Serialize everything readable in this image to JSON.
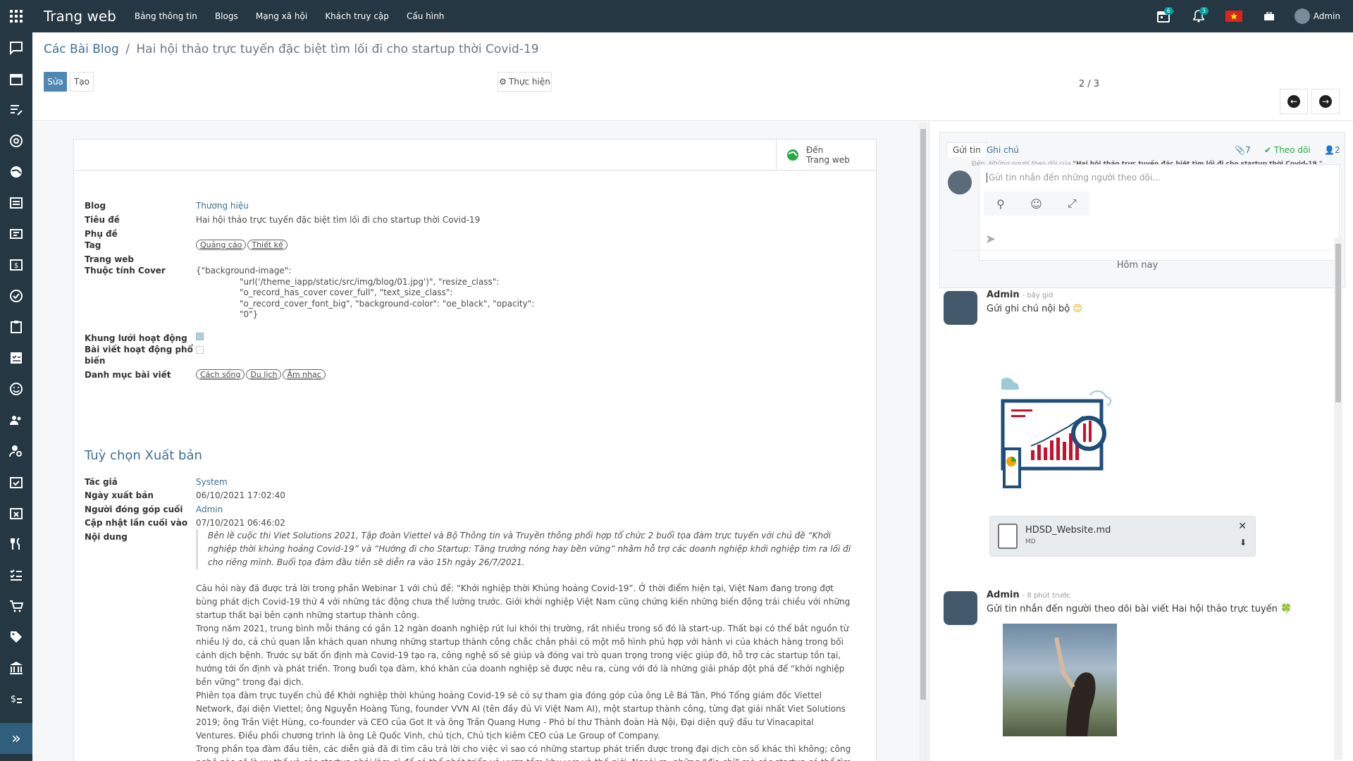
{
  "topbar": {
    "brand": "Trang web",
    "menu": [
      "Bảng thông tin",
      "Blogs",
      "Mạng xã hội",
      "Khách truy cập",
      "Cấu hình"
    ],
    "calendar_badge": "6",
    "bell_badge": "3",
    "user": "Admin"
  },
  "breadcrumb": {
    "parent": "Các Bài Blog",
    "sep": "/",
    "current": "Hai hội thảo trực tuyến đặc biệt tìm lối đi cho startup thời Covid-19"
  },
  "toolbar": {
    "edit": "Sửa",
    "create": "Tạo",
    "action": "Thực hiện",
    "pager": "2 / 3"
  },
  "smart": {
    "line1": "Đến",
    "line2": "Trang web"
  },
  "fields": {
    "blog_label": "Blog",
    "blog_value": "Thương hiệu",
    "title_label": "Tiêu đề",
    "title_value": "Hai hội thảo trực tuyến đặc biệt tìm lối đi cho startup thời Covid-19",
    "subtitle_label": "Phụ đề",
    "tag_label": "Tag",
    "tags": [
      "Quảng cáo",
      "Thiết kế"
    ],
    "website_label": "Trang web",
    "cover_label": "Thuộc tính Cover",
    "cover_lines": [
      "{\"background-image\":",
      "\"url('/theme_iapp/static/src/img/blog/01.jpg')\", \"resize_class\":",
      "\"o_record_has_cover cover_full\", \"text_size_class\":",
      "\"o_record_cover_font_big\", \"background-color\": \"oe_black\", \"opacity\":",
      "\"0\"}"
    ],
    "grid_label": "Khung lưới hoạt động",
    "popular_label1": "Bài viết hoạt động phổ",
    "popular_label2": "biến",
    "category_label": "Danh mục bài viết",
    "categories": [
      "Cách sống",
      "Du lịch",
      "Âm nhạc"
    ]
  },
  "publish": {
    "section": "Tuỳ chọn Xuất bản",
    "author_label": "Tác giả",
    "author": "System",
    "pubdate_label": "Ngày xuất bản",
    "pubdate": "06/10/2021 17:02:40",
    "contrib_label": "Người đóng góp cuối",
    "contrib": "Admin",
    "updated_label": "Cập nhật lần cuối vào",
    "updated": "07/10/2021 06:46:02",
    "content_label": "Nội dung"
  },
  "content": {
    "quote": "Bên lề cuộc thi Viet Solutions 2021, Tập đoàn Viettel và Bộ Thông tin và Truyền thông phối hợp tổ chức 2 buổi tọa đàm trực tuyến với chủ đề “Khởi nghiệp thời khủng hoảng Covid-19” và “Hướng đi cho Startup: Tăng trưởng nóng hay bền vững” nhằm hỗ trợ các doanh nghiệp khởi nghiệp tìm ra lối đi cho riêng mình. Buổi tọa đàm đầu tiên sẽ diễn ra vào 15h ngày 26/7/2021.",
    "p1": "Câu hỏi này đã được trả lời trong phần Webinar 1 với chủ đề: “Khởi nghiệp thời Khủng hoảng Covid-19”. Ở thời điểm hiện tại, Việt Nam đang trong đợt bùng phát dịch Covid-19 thứ 4 với những tác động chưa thể lường trước. Giới khởi nghiệp Việt Nam cũng chứng kiến những biến động trái chiều với những startup thất bại bên cạnh những startup thành công.",
    "p2": "Trong năm 2021, trung bình mỗi tháng có gần 12 ngàn doanh nghiệp rút lui khỏi thị trường, rất nhiều trong số đó là start-up. Thất bại có thể bắt nguồn từ nhiều lý do, cả chủ quan lẫn khách quan nhưng những startup thành công chắc chắn phải có một mô hình phủ hợp với hành vi của khách hàng trong bối cảnh dịch bệnh. Trước sự bất ổn định mà Covid-19 tạo ra, công nghệ số sẽ giúp và đóng vai trò quan trọng trong việc giúp đỡ, hỗ trợ các startup tồn tại, hướng tới ổn định và phát triển. Trong buổi tọa đàm, khó khăn của doanh nghiệp sẽ được nêu ra, cùng với đó là những giải pháp đột phá để “khởi nghiệp bền vững” trong đại dịch.",
    "p3": "Phiên tọa đàm trực tuyến chủ đề Khởi nghiệp thời khủng hoảng Covid-19 sẽ có sự tham gia đóng góp của ông Lê Bá Tân, Phó Tổng giám đốc Viettel Network, đại diện Viettel; ông Nguyễn Hoàng Tùng, founder VVN AI (tên đầy đủ Vi Việt Nam AI), một startup thành công, từng đạt giải nhất Viet Solutions 2019; ông Trần Việt Hùng, co-founder và CEO của Got It và ông Trần Quang Hưng - Phó bí thư Thành đoàn Hà Nội, Đại diện quỹ đầu tư Vinacapital Ventures. Điều phối chương trình là ông Lê Quốc Vinh, chủ tịch, Chủ tịch kiêm CEO của Le Group of Company.",
    "p4": "Trong phần tọa đàm đầu tiên, các diễn giả đã đi tìm câu trả lời cho việc vì sao có những startup phát triển được trong đại dịch còn số khác thì không; công nghệ nào sẽ là xu thế và các startup phải làm gì để có thể phát triển và vươn tầm khu vực và thế giới. Ngoài ra, những “địa chỉ” mà các startup có thể tìm tới để nhận"
  },
  "chatter": {
    "send_tab": "Gửi tin",
    "note_tab": "Ghi chú",
    "attach_count": "7",
    "follow": "Theo dõi",
    "followers": "2",
    "to_prefix": "Đến:",
    "to_mid": "Những người theo dõi của",
    "to_doc": "\"Hai hội thảo trực tuyến đặc biệt tìm lối đi cho startup thời Covid-19 \"",
    "placeholder": "Gửi tin nhắn đến những người theo dõi...",
    "today": "Hôm nay",
    "m1_author": "Admin",
    "m1_time": "- bây giờ",
    "m1_body": "Gửi ghi chú nội bộ",
    "file_name": "HDSD_Website.md",
    "file_ext": "MD",
    "m2_author": "Admin",
    "m2_time": "- 8 phút trước",
    "m2_body": "Gửi tin nhắn đến người theo dõi bài viết Hai hội thảo trực tuyến"
  }
}
